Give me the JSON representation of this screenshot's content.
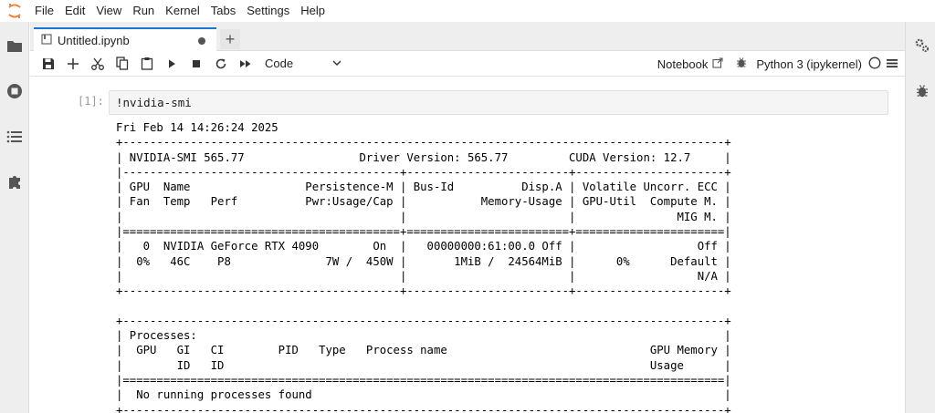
{
  "menu": {
    "items": [
      "File",
      "Edit",
      "View",
      "Run",
      "Kernel",
      "Tabs",
      "Settings",
      "Help"
    ]
  },
  "tab": {
    "title": "Untitled.ipynb"
  },
  "toolbar": {
    "cell_type": "Code",
    "notebook_label": "Notebook",
    "kernel_name": "Python 3 (ipykernel)"
  },
  "cell": {
    "prompt": "[1]:",
    "code": "!nvidia-smi",
    "output_lines": [
      "Fri Feb 14 14:26:24 2025",
      "+-----------------------------------------------------------------------------------------+",
      "| NVIDIA-SMI 565.77                 Driver Version: 565.77         CUDA Version: 12.7     |",
      "|-----------------------------------------+------------------------+----------------------+",
      "| GPU  Name                 Persistence-M | Bus-Id          Disp.A | Volatile Uncorr. ECC |",
      "| Fan  Temp   Perf          Pwr:Usage/Cap |           Memory-Usage | GPU-Util  Compute M. |",
      "|                                         |                        |               MIG M. |",
      "|=========================================+========================+======================|",
      "|   0  NVIDIA GeForce RTX 4090        On  |   00000000:61:00.0 Off |                  Off |",
      "|  0%   46C    P8              7W /  450W |       1MiB /  24564MiB |      0%      Default |",
      "|                                         |                        |                  N/A |",
      "+-----------------------------------------+------------------------+----------------------+",
      "",
      "+-----------------------------------------------------------------------------------------+",
      "| Processes:                                                                              |",
      "|  GPU   GI   CI        PID   Type   Process name                              GPU Memory |",
      "|        ID   ID                                                               Usage      |",
      "|=========================================================================================|",
      "|  No running processes found                                                             |",
      "+-----------------------------------------------------------------------------------------+"
    ]
  }
}
